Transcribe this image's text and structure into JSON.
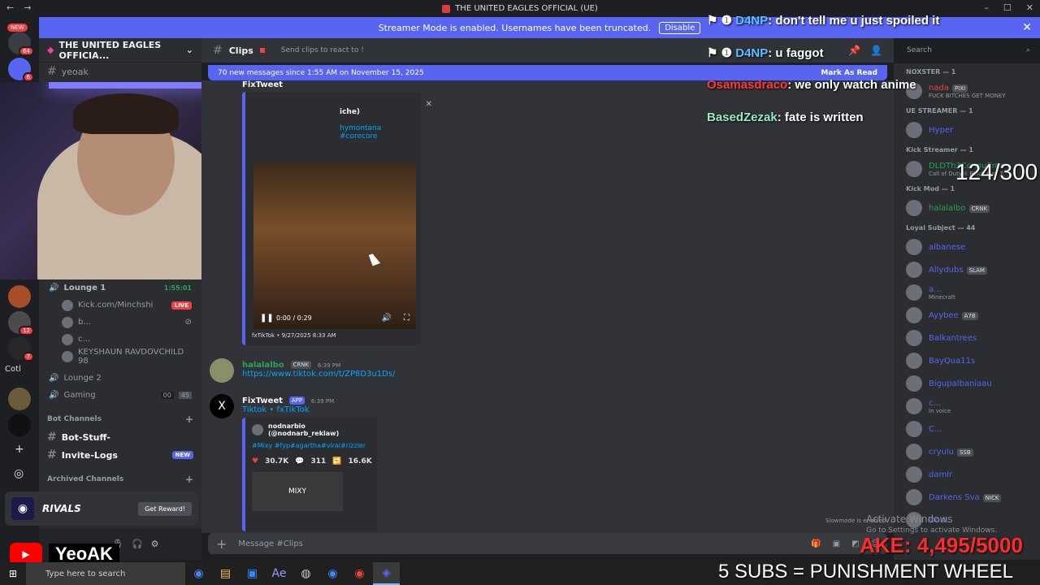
{
  "window": {
    "title": "THE UNITED EAGLES OFFICIAL (UE)"
  },
  "banner": {
    "text": "Streamer Mode is enabled. Usernames have been truncated.",
    "button": "Disable"
  },
  "server": {
    "name": "THE UNITED EAGLES OFFICIA...",
    "new_badge": "NEW",
    "badges": [
      "64",
      "6"
    ]
  },
  "sidebar": {
    "top_channel": "yeoak",
    "voice": {
      "lounge1": {
        "label": "Lounge 1",
        "time": "1:55:01"
      },
      "users": [
        {
          "name": "Kick.com/Minchshi",
          "live": "LIVE"
        },
        {
          "name": "b..."
        },
        {
          "name": "c..."
        },
        {
          "name": "KEYSHAUN RAVDOVCHILD 98"
        }
      ],
      "lounge2": {
        "label": "Lounge 2"
      },
      "gaming": {
        "label": "Gaming",
        "count_a": "00",
        "count_b": "45"
      }
    },
    "bot_category": "Bot Channels",
    "bot_channels": [
      {
        "name": "Bot-Stuff-"
      },
      {
        "name": "Invite-Logs",
        "badge": "NEW"
      }
    ],
    "archived": "Archived Channels",
    "rail_labels": [
      "Cotl",
      "12",
      "7"
    ]
  },
  "ad": {
    "brand": "RIVALS",
    "button": "Get Reward!"
  },
  "youtube": {
    "name": "YeoAK"
  },
  "channel": {
    "name": "Clips",
    "topic": "Send clips to react to !"
  },
  "newmessages": {
    "text": "70 new messages since 1:55 AM on November 15, 2025",
    "mark": "Mark As Read"
  },
  "messages": {
    "top_embed": {
      "author": "FixTweet",
      "app_tag": "APP",
      "line1": "iche)",
      "line2": "hymontana #corecore",
      "footer": "fxTikTok • 9/27/2025 8:33 AM",
      "player_time": "0:00 / 0:29"
    },
    "m1": {
      "user": "halalalbo",
      "tag": "CRNK",
      "time": "6:39 PM",
      "link": "https://www.tiktok.com/t/ZP8D3u1Ds/"
    },
    "m2": {
      "user": "FixTweet",
      "tag": "APP",
      "time": "6:39 PM",
      "sub": "Tiktok • fxTikTok",
      "embed_author": "nodnarbio (@nodnarb_reklaw)",
      "tags": "#Mixy #fyp#agartha#viral#rizzler",
      "likes": "30.7K",
      "comments": "311",
      "shares": "16.6K",
      "thumb_text": "MIXY"
    }
  },
  "composer": {
    "placeholder": "Message #Clips"
  },
  "slowmode": "Slowmode is enabled",
  "search": {
    "placeholder": "Search"
  },
  "members": {
    "groups": [
      {
        "label": "NOXSTER — 1",
        "members": [
          {
            "name": "nada",
            "tag": "PIXI",
            "sub": "FUCK BITCHES GET MONEY",
            "color": "#f23f43"
          }
        ]
      },
      {
        "label": "UE STREAMER — 1",
        "members": [
          {
            "name": "Hyper",
            "color": "#5865f2"
          }
        ]
      },
      {
        "label": "Kick Streamer — 1",
        "members": [
          {
            "name": "DLDTh3Ccnqu3ror",
            "sub": "Call of Duty® Black Ops 7",
            "color": "#23a55a"
          }
        ]
      },
      {
        "label": "Kick Mod — 1",
        "members": [
          {
            "name": "halalalbo",
            "tag": "CRNK",
            "color": "#23a55a"
          }
        ]
      },
      {
        "label": "Loyal Subject — 44",
        "members": [
          {
            "name": "albanese",
            "color": "#5865f2"
          },
          {
            "name": "Allydubs",
            "tag": "SLAM",
            "color": "#5865f2"
          },
          {
            "name": "a...",
            "sub": "Minecraft",
            "color": "#5865f2"
          },
          {
            "name": "Ayybee",
            "tag": "A7B",
            "color": "#5865f2"
          },
          {
            "name": "Balkantrees",
            "color": "#5865f2"
          },
          {
            "name": "BayQua11s",
            "color": "#5865f2"
          },
          {
            "name": "Bigupalbaniaau",
            "color": "#5865f2"
          },
          {
            "name": "c...",
            "sub": "In voice",
            "color": "#5865f2"
          },
          {
            "name": "C...",
            "color": "#5865f2"
          },
          {
            "name": "cryulu",
            "tag": "SSB",
            "color": "#5865f2"
          },
          {
            "name": "damlr",
            "color": "#5865f2"
          },
          {
            "name": "Darkens Sva",
            "tag": "NICK",
            "color": "#5865f2"
          },
          {
            "name": "Dom",
            "color": "#5865f2"
          }
        ]
      }
    ]
  },
  "overlay": {
    "chat": [
      {
        "user": "D4NP",
        "text": "don't tell me u just spoiled it",
        "color": "#5bc0ff"
      },
      {
        "user": "D4NP",
        "text": "u faggot",
        "color": "#5bc0ff"
      },
      {
        "user": "Osamasdraco",
        "text": "we only watch anime",
        "color": "#ff3b3b"
      },
      {
        "user": "BasedZezak",
        "text": "fate is written",
        "color": "#9be7c4"
      }
    ],
    "counter": "124/300",
    "goal": "AKE: 4,495/5000",
    "subs": "5 SUBS = PUNISHMENT WHEEL",
    "activate": "Activate Windows",
    "activate_sub": "Go to Settings to activate Windows."
  },
  "taskbar": {
    "search": "Type here to search"
  }
}
